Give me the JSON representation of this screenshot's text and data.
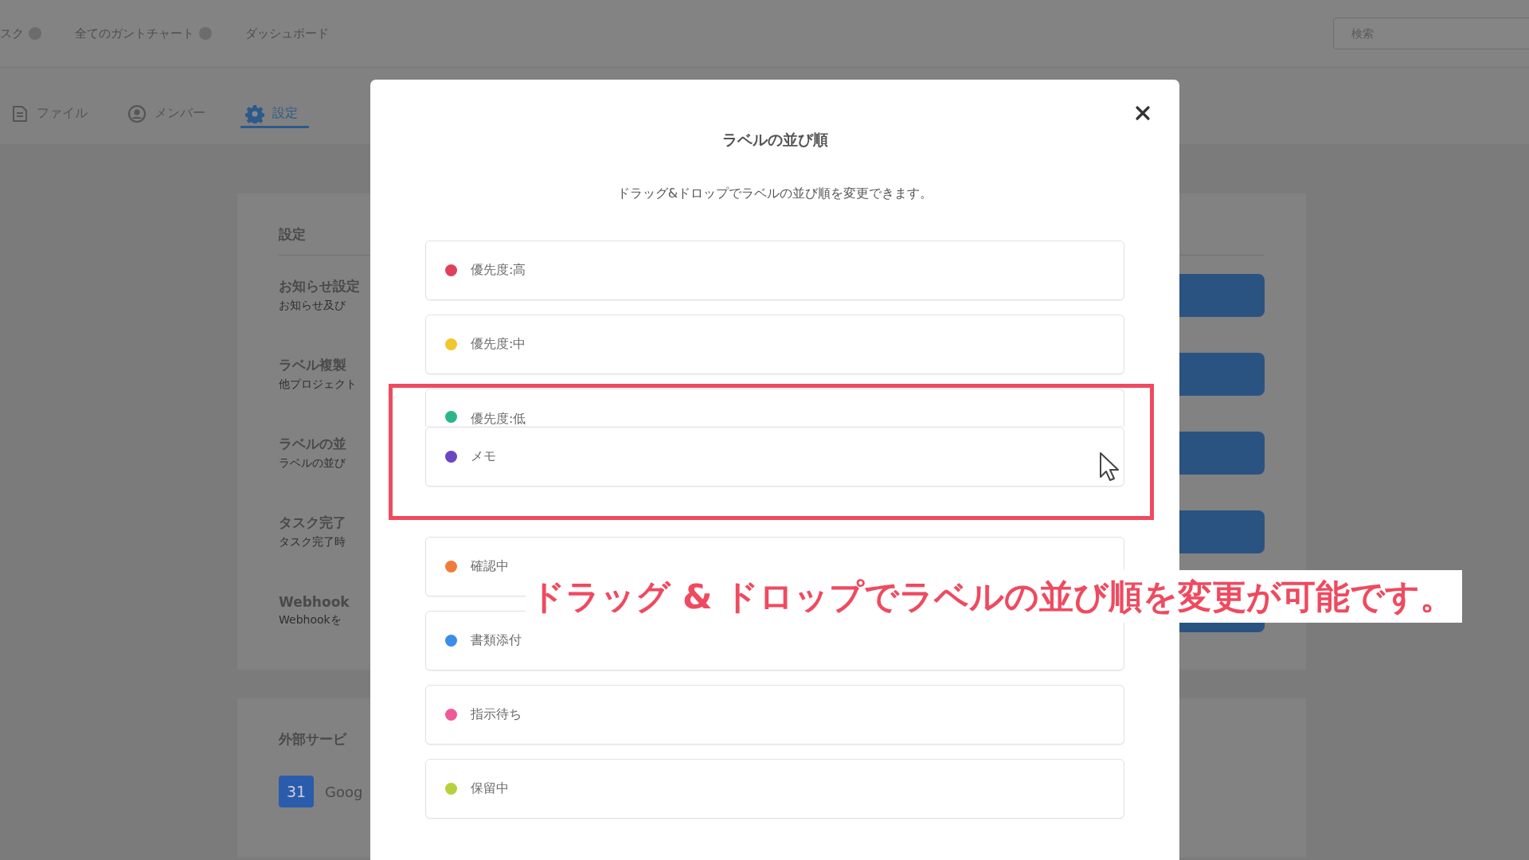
{
  "top_nav": {
    "items": [
      {
        "label": "スク",
        "badge": true
      },
      {
        "label": "全てのガントチャート",
        "badge": true
      },
      {
        "label": "ダッシュボード",
        "badge": false
      }
    ],
    "search": {
      "placeholder": "検索"
    }
  },
  "project_tabs": [
    {
      "label": "ファイル",
      "selected": false
    },
    {
      "label": "メンバー",
      "selected": false
    },
    {
      "label": "設定",
      "selected": true
    }
  ],
  "settings": {
    "heading": "設定",
    "rows": [
      {
        "title": "お知らせ設定",
        "subtitle": "お知らせ及び"
      },
      {
        "title": "ラベル複製",
        "subtitle": "他プロジェクト"
      },
      {
        "title": "ラベルの並",
        "subtitle": "ラベルの並び"
      },
      {
        "title": "タスク完了",
        "subtitle": "タスク完了時"
      },
      {
        "title": "Webhook",
        "subtitle": "Webhookを"
      }
    ]
  },
  "external_services": {
    "heading": "外部サービ",
    "items": [
      {
        "icon_text": "31",
        "name": "Goog"
      }
    ]
  },
  "modal": {
    "title": "ラベルの並び順",
    "description": "ドラッグ&ドロップでラベルの並び順を変更できます。",
    "labels": [
      {
        "name": "優先度:高",
        "color": "#e0405a",
        "dragging": false
      },
      {
        "name": "優先度:中",
        "color": "#f2c62c",
        "dragging": false
      },
      {
        "name": "優先度:低",
        "color": "#2bb58a",
        "dragging": false
      },
      {
        "name": "メモ",
        "color": "#6a46c0",
        "dragging": true
      },
      {
        "name": "確認中",
        "color": "#f07c3c",
        "dragging": false
      },
      {
        "name": "書類添付",
        "color": "#3a8ee8",
        "dragging": false
      },
      {
        "name": "指示待ち",
        "color": "#ee5a9a",
        "dragging": false
      },
      {
        "name": "保留中",
        "color": "#b5d13c",
        "dragging": false
      }
    ]
  },
  "annotation": {
    "caption": "ドラッグ & ドロップでラベルの並び順を変更が可能です。"
  }
}
